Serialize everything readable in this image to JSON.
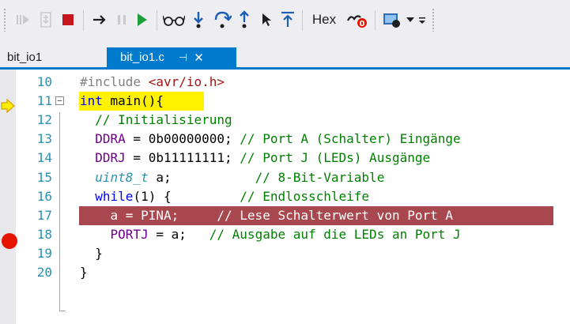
{
  "toolbar": {
    "hex_label": "Hex",
    "icons": [
      "show-next-statement-icon",
      "step-into-specific-icon",
      "stop-debugging-icon",
      "show-next-statement-arrow-icon",
      "break-all-icon",
      "continue-icon",
      "ghost-glasses-icon",
      "step-into-icon",
      "step-over-icon",
      "step-out-icon",
      "select-pointer-icon",
      "step-to-top-icon",
      "hex-toggle",
      "visualizer-icon",
      "screen-capture-icon",
      "overflow-icon"
    ]
  },
  "tabs": [
    {
      "label": "bit_io1",
      "active": false
    },
    {
      "label": "bit_io1.c",
      "active": true
    }
  ],
  "pin_glyph": "⊣",
  "close_glyph": "✕",
  "editor": {
    "lines": [
      {
        "num": "10",
        "tokens": [
          [
            "pp",
            "#include "
          ],
          [
            "st",
            "<avr/io.h>"
          ]
        ]
      },
      {
        "num": "11",
        "tokens": [
          [
            "kw",
            "int"
          ],
          [
            "num",
            " main(){"
          ]
        ]
      },
      {
        "num": "12",
        "tokens": [
          [
            "num",
            "  "
          ],
          [
            "cm",
            "// Initialisierung"
          ]
        ]
      },
      {
        "num": "13",
        "tokens": [
          [
            "num",
            "  "
          ],
          [
            "mc",
            "DDRA"
          ],
          [
            "num",
            " = 0b00000000; "
          ],
          [
            "cm",
            "// Port A (Schalter) Eingänge"
          ]
        ]
      },
      {
        "num": "14",
        "tokens": [
          [
            "num",
            "  "
          ],
          [
            "mc",
            "DDRJ"
          ],
          [
            "num",
            " = 0b11111111; "
          ],
          [
            "cm",
            "// Port J (LEDs) Ausgänge"
          ]
        ]
      },
      {
        "num": "15",
        "tokens": [
          [
            "num",
            "  "
          ],
          [
            "it",
            "uint8_t"
          ],
          [
            "num",
            " a;           "
          ],
          [
            "cm",
            "// 8-Bit-Variable"
          ]
        ]
      },
      {
        "num": "16",
        "tokens": [
          [
            "num",
            "  "
          ],
          [
            "kw",
            "while"
          ],
          [
            "num",
            "(1) {         "
          ],
          [
            "cm",
            "// Endlosschleife"
          ]
        ]
      },
      {
        "num": "17",
        "tokens": [
          [
            "num",
            "    a = PINA;     // Lese Schalterwert von Port A"
          ]
        ]
      },
      {
        "num": "18",
        "tokens": [
          [
            "num",
            "    "
          ],
          [
            "mc",
            "PORTJ"
          ],
          [
            "num",
            " = a;   "
          ],
          [
            "cm",
            "// Ausgabe auf die LEDs an Port J"
          ]
        ]
      },
      {
        "num": "19",
        "tokens": [
          [
            "num",
            "  }"
          ]
        ]
      },
      {
        "num": "20",
        "tokens": [
          [
            "num",
            "}"
          ]
        ]
      }
    ]
  },
  "colors": {
    "accent": "#007acc",
    "current_line": "#fff200",
    "breakpoint_line": "#a9474e",
    "breakpoint_dot": "#e51400",
    "stop": "#c4161c",
    "continue": "#1e9e3a"
  }
}
